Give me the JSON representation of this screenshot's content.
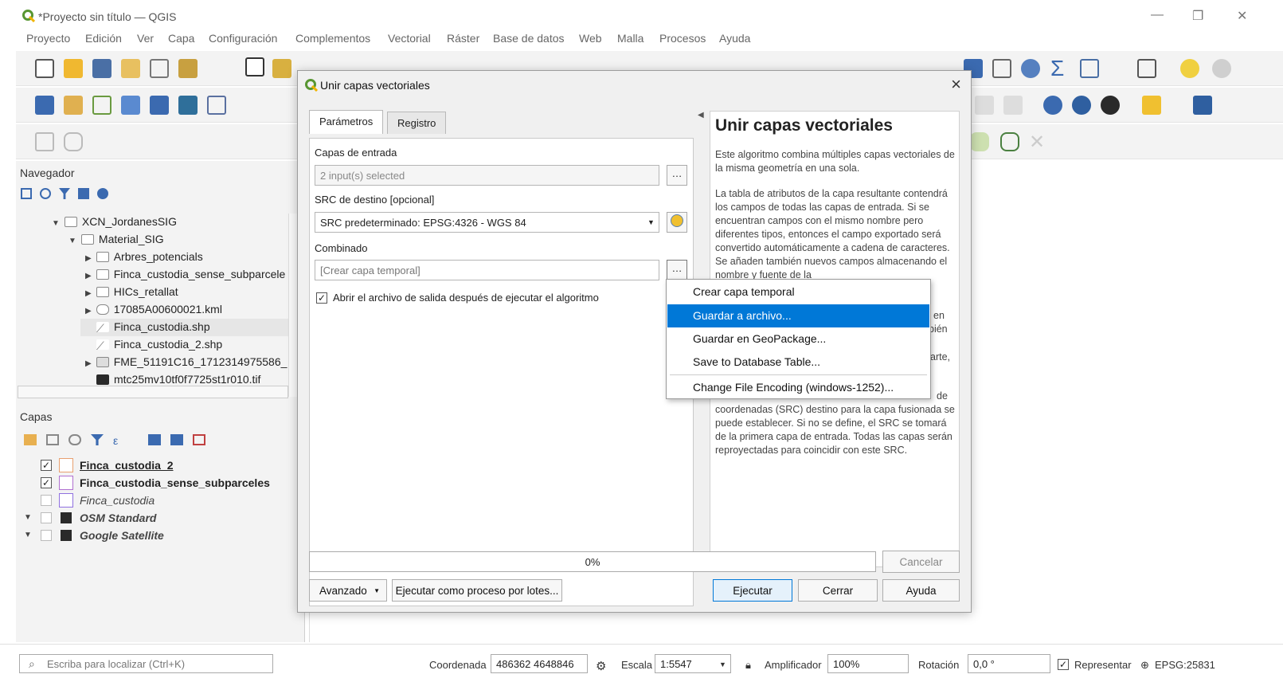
{
  "window": {
    "title": "*Proyecto sin título — QGIS"
  },
  "menu": [
    "Proyecto",
    "Edición",
    "Ver",
    "Capa",
    "Configuración",
    "Complementos",
    "Vectorial",
    "Ráster",
    "Base de datos",
    "Web",
    "Malla",
    "Procesos",
    "Ayuda"
  ],
  "browser": {
    "title": "Navegador",
    "items": [
      {
        "label": "XCN_JordanesSIG",
        "kind": "folder",
        "expanded": true
      },
      {
        "label": "Material_SIG",
        "kind": "folder",
        "expanded": true
      },
      {
        "label": "Arbres_potencials",
        "kind": "folder"
      },
      {
        "label": "Finca_custodia_sense_subparcele",
        "kind": "folder"
      },
      {
        "label": "HICs_retallat",
        "kind": "folder"
      },
      {
        "label": "17085A00600021.kml",
        "kind": "db"
      },
      {
        "label": "Finca_custodia.shp",
        "kind": "shp"
      },
      {
        "label": "Finca_custodia_2.shp",
        "kind": "shp"
      },
      {
        "label": "FME_51191C16_1712314975586_",
        "kind": "raster"
      },
      {
        "label": "mtc25mv10tf0f7725st1r010.tif",
        "kind": "raster"
      }
    ]
  },
  "layers": {
    "title": "Capas",
    "items": [
      {
        "label": "Finca_custodia_2",
        "checked": true,
        "style": "bold-underline",
        "color": "#e8a070"
      },
      {
        "label": "Finca_custodia_sense_subparceles",
        "checked": true,
        "style": "bold",
        "color": "#b070d0"
      },
      {
        "label": "Finca_custodia",
        "checked": false,
        "style": "italic",
        "color": "#9070e0"
      },
      {
        "label": "OSM Standard",
        "checked": false,
        "style": "italic-bold"
      },
      {
        "label": "Google Satellite",
        "checked": false,
        "style": "italic-bold"
      }
    ]
  },
  "dialog": {
    "title": "Unir capas vectoriales",
    "tabs": [
      "Parámetros",
      "Registro"
    ],
    "input_label": "Capas de entrada",
    "input_value": "2 input(s) selected",
    "crs_label": "SRC de destino [opcional]",
    "crs_value": "SRC predeterminado: EPSG:4326 - WGS 84",
    "merged_label": "Combinado",
    "merged_placeholder": "[Crear capa temporal]",
    "open_checkbox": "Abrir el archivo de salida después de ejecutar el algoritmo",
    "help_title": "Unir capas vectoriales",
    "help_p1": "Este algoritmo combina múltiples capas vectoriales de la misma geometría en una sola.",
    "help_p2": "La tabla de atributos de la capa resultante contendrá los campos de todas las capas de entrada. Si se encuentran campos con el mismo nombre pero diferentes tipos, entonces el campo exportado será convertido automáticamente a cadena de caracteres. Se añaden también nuevos campos almacenando el nombre y fuente de la",
    "help_frag1": "en",
    "help_frag2": "bién",
    "help_frag3": "arte,",
    "help_frag4": "de",
    "help_p3": "coordenadas (SRC) destino para la capa fusionada se puede establecer. Si no se define, el SRC se tomará de la primera capa de entrada. Todas las capas serán reproyectadas para coincidir con este SRC.",
    "progress": "0%",
    "cancel": "Cancelar",
    "advanced": "Avanzado",
    "batch": "Ejecutar como proceso por lotes...",
    "run": "Ejecutar",
    "close": "Cerrar",
    "help": "Ayuda"
  },
  "dropdown": {
    "items": [
      "Crear capa temporal",
      "Guardar a archivo...",
      "Guardar en GeoPackage...",
      "Save to Database Table...",
      "Change File Encoding (windows-1252)..."
    ],
    "selected_index": 1
  },
  "status": {
    "locator_placeholder": "Escriba para localizar (Ctrl+K)",
    "coord_label": "Coordenada",
    "coord_value": "486362  4648846",
    "scale_label": "Escala",
    "scale_value": "1:5547",
    "magnifier_label": "Amplificador",
    "magnifier_value": "100%",
    "rotation_label": "Rotación",
    "rotation_value": "0,0 °",
    "render_label": "Representar",
    "crs": "EPSG:25831"
  },
  "colors": {
    "accent": "#0078d7",
    "qgis_green": "#589632"
  }
}
